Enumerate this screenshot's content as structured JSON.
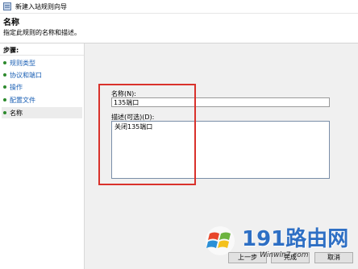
{
  "window": {
    "title": "新建入站规则向导",
    "icon": "firewall-rule-icon"
  },
  "header": {
    "title": "名称",
    "subtitle": "指定此规则的名称和描述。"
  },
  "sidebar": {
    "heading": "步骤:",
    "steps": [
      {
        "label": "规则类型",
        "current": false
      },
      {
        "label": "协议和端口",
        "current": false
      },
      {
        "label": "操作",
        "current": false
      },
      {
        "label": "配置文件",
        "current": false
      },
      {
        "label": "名称",
        "current": true
      }
    ]
  },
  "form": {
    "name_label": "名称(N):",
    "name_value": "135端口",
    "description_label": "描述(可选)(D):",
    "description_value": "关闭135端口"
  },
  "buttons": {
    "prev": "上一步",
    "next": "完成",
    "cancel": "取消"
  },
  "watermark": {
    "text": "191路由网",
    "url": "Winwin7.com"
  },
  "colors": {
    "highlight": "#d9312b",
    "step_link": "#1a5fb4",
    "step_dot": "#2d8a2d",
    "content_bg": "#f0f0f0"
  }
}
